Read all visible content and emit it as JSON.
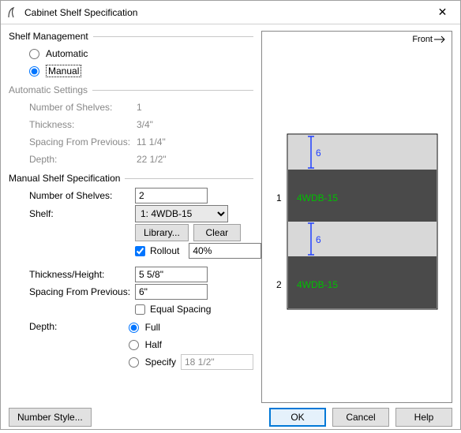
{
  "window": {
    "title": "Cabinet Shelf Specification",
    "close_glyph": "✕"
  },
  "shelf_management": {
    "header": "Shelf Management",
    "automatic_label": "Automatic",
    "manual_label": "Manual",
    "selected": "manual"
  },
  "automatic_settings": {
    "header": "Automatic Settings",
    "rows": {
      "num_shelves": {
        "label": "Number of Shelves:",
        "value": "1"
      },
      "thickness": {
        "label": "Thickness:",
        "value": "3/4\""
      },
      "spacing": {
        "label": "Spacing From Previous:",
        "value": "11 1/4\""
      },
      "depth": {
        "label": "Depth:",
        "value": "22 1/2\""
      }
    }
  },
  "manual_spec": {
    "header": "Manual Shelf Specification",
    "num_shelves_label": "Number of Shelves:",
    "num_shelves_value": "2",
    "shelf_label": "Shelf:",
    "shelf_value": "1: 4WDB-15",
    "library_btn": "Library...",
    "clear_btn": "Clear",
    "rollout_label": "Rollout",
    "rollout_checked": true,
    "rollout_value": "40%",
    "thickness_label": "Thickness/Height:",
    "thickness_value": "5 5/8\"",
    "spacing_label": "Spacing From Previous:",
    "spacing_value": "6\"",
    "equal_spacing_label": "Equal Spacing",
    "equal_spacing_checked": false,
    "depth_label": "Depth:",
    "depth_options": {
      "full": "Full",
      "half": "Half",
      "specify": "Specify"
    },
    "depth_selected": "full",
    "specify_value": "18 1/2\""
  },
  "preview": {
    "front_label": "Front",
    "items": [
      {
        "index": "1",
        "label": "4WDB-15",
        "dim": "6"
      },
      {
        "index": "2",
        "label": "4WDB-15",
        "dim": "6"
      }
    ]
  },
  "footer": {
    "number_style": "Number Style...",
    "ok": "OK",
    "cancel": "Cancel",
    "help": "Help"
  }
}
